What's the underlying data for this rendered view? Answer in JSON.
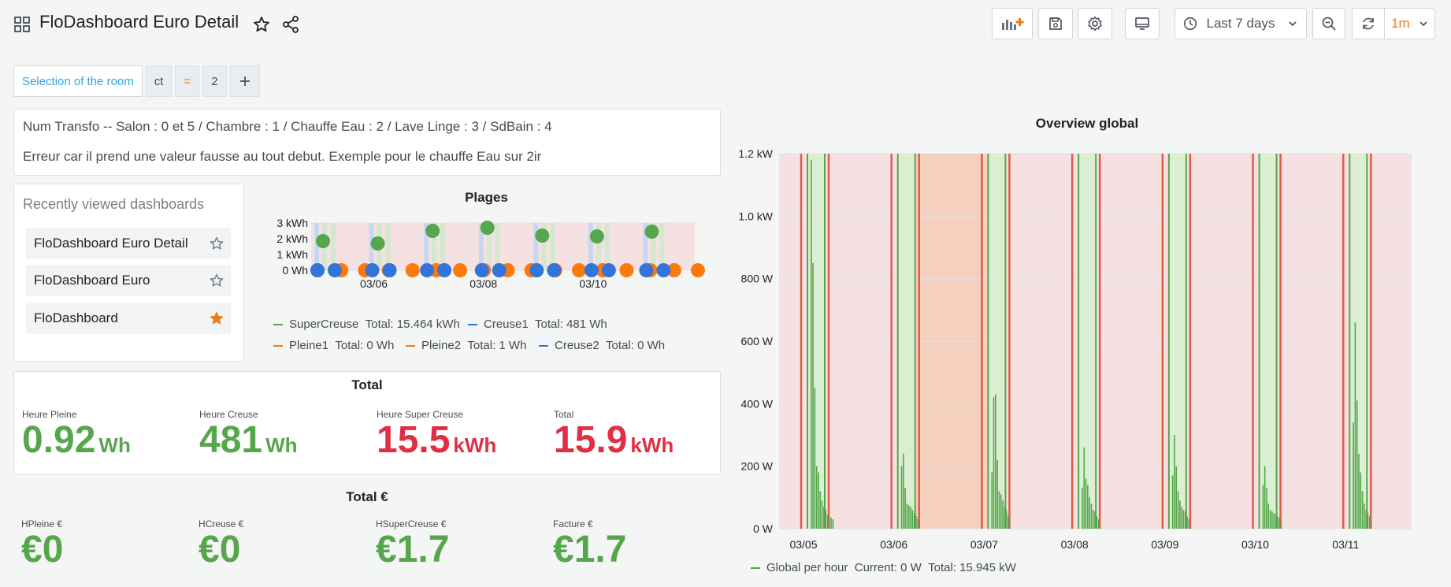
{
  "header": {
    "title": "FloDashboard Euro Detail",
    "time_range": "Last 7 days",
    "refresh_interval": "1m"
  },
  "variables": {
    "label": "Selection of the room",
    "filter_key": "ct",
    "filter_operator": "=",
    "filter_value": "2"
  },
  "text_panel": {
    "line1": "Num Transfo -- Salon : 0 et 5 / Chambre : 1 / Chauffe Eau : 2 / Lave Linge : 3 / SdBain : 4",
    "line2": "Erreur car il prend une valeur fausse au tout debut. Exemple pour le chauffe Eau sur 2ir"
  },
  "recent": {
    "title": "Recently viewed dashboards",
    "items": [
      {
        "label": "FloDashboard Euro Detail",
        "starred": false
      },
      {
        "label": "FloDashboard Euro",
        "starred": false
      },
      {
        "label": "FloDashboard",
        "starred": true
      }
    ]
  },
  "total_panel": {
    "title": "Total",
    "stats": [
      {
        "label": "Heure Pleine",
        "value": "0.92",
        "unit": "Wh",
        "color": "#56a64b"
      },
      {
        "label": "Heure Creuse",
        "value": "481",
        "unit": "Wh",
        "color": "#56a64b"
      },
      {
        "label": "Heure Super Creuse",
        "value": "15.5",
        "unit": "kWh",
        "color": "#e02f44"
      },
      {
        "label": "Total",
        "value": "15.9",
        "unit": "kWh",
        "color": "#e02f44"
      }
    ]
  },
  "euro_panel": {
    "title": "Total €",
    "stats": [
      {
        "label": "HPleine €",
        "value": "€0",
        "color": "#56a64b"
      },
      {
        "label": "HCreuse €",
        "value": "€0",
        "color": "#56a64b"
      },
      {
        "label": "HSuperCreuse €",
        "value": "€1.7",
        "color": "#56a64b"
      },
      {
        "label": "Facture €",
        "value": "€1.7",
        "color": "#56a64b"
      }
    ]
  },
  "colors": {
    "green": "#56a64b",
    "orange": "#ff780a",
    "blue": "#3274d9",
    "red_line": "#e05a4a",
    "red_band": "#f5dada",
    "orange_band": "#f4cdb7",
    "accent": "#eb7b18"
  },
  "chart_data": [
    {
      "type": "scatter",
      "title": "Plages",
      "ylabel": "",
      "ylim": [
        0,
        3
      ],
      "yticks": [
        "0 Wh",
        "1 kWh",
        "2 kWh",
        "3 kWh"
      ],
      "xticks": [
        "03/06",
        "03/08",
        "03/10"
      ],
      "series": [
        {
          "name": "SuperCreuse",
          "color": "#56a64b",
          "values": [
            1.85,
            1.7,
            2.5,
            2.7,
            2.2,
            2.15,
            2.45
          ]
        },
        {
          "name": "Creuse1",
          "color": "#3274d9",
          "values": [
            0,
            0,
            0,
            0,
            0,
            0,
            0
          ]
        },
        {
          "name": "Pleine1",
          "color": "#ff780a",
          "values": [
            0,
            0,
            0,
            0,
            0,
            0,
            0,
            0,
            0,
            0,
            0,
            0,
            0,
            0,
            0,
            0,
            0
          ]
        },
        {
          "name": "Pleine2",
          "color": "#ff780a",
          "values": []
        },
        {
          "name": "Creuse2",
          "color": "#3274d9",
          "values": []
        }
      ],
      "legend": [
        {
          "name": "SuperCreuse",
          "total": "Total: 15.464 kWh",
          "color": "#56a64b"
        },
        {
          "name": "Creuse1",
          "total": "Total: 481 Wh",
          "color": "#3274d9"
        },
        {
          "name": "Pleine1",
          "total": "Total: 0 Wh",
          "color": "#ff780a"
        },
        {
          "name": "Pleine2",
          "total": "Total: 1 Wh",
          "color": "#ff780a"
        },
        {
          "name": "Creuse2",
          "total": "Total: 0 Wh",
          "color": "#3274d9"
        }
      ]
    },
    {
      "type": "bar",
      "title": "Overview global",
      "ylim": [
        0,
        1200
      ],
      "yticks": [
        "0 W",
        "200 W",
        "400 W",
        "600 W",
        "800 W",
        "1.0 kW",
        "1.2 kW"
      ],
      "xticks": [
        "03/05",
        "03/06",
        "03/07",
        "03/08",
        "03/09",
        "03/10",
        "03/11"
      ],
      "series": [
        {
          "name": "Global per hour",
          "color": "#56a64b",
          "daily_peaks_w": [
            [
              1180,
              850,
              450,
              200,
              180,
              120,
              90,
              70,
              60,
              45,
              40,
              35,
              30
            ],
            [
              200,
              240,
              130,
              80,
              75,
              70,
              60,
              50,
              40,
              30
            ],
            [
              180,
              420,
              430,
              220,
              120,
              110,
              90,
              70,
              60,
              40
            ],
            [
              130,
              260,
              160,
              140,
              100,
              80,
              60,
              55,
              40,
              30
            ],
            [
              170,
              300,
              200,
              120,
              90,
              70,
              60,
              55,
              40,
              30
            ],
            [
              140,
              200,
              130,
              80,
              60,
              55,
              50,
              45,
              40,
              35,
              30
            ],
            [
              340,
              660,
              410,
              240,
              180,
              120,
              80,
              60,
              50,
              40
            ]
          ]
        }
      ],
      "legend": {
        "name": "Global per hour",
        "current": "Current: 0 W",
        "total": "Total: 15.945 kW"
      }
    }
  ]
}
